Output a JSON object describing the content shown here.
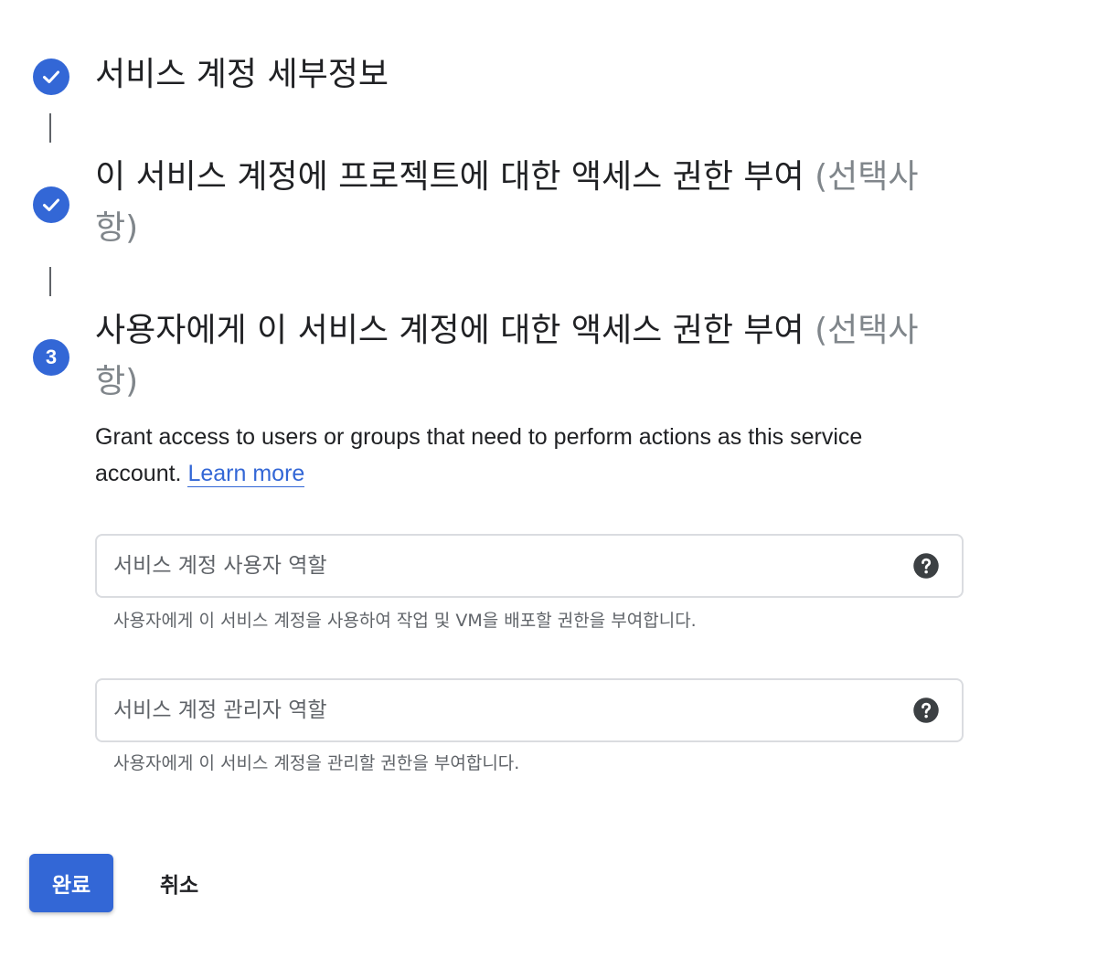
{
  "steps": [
    {
      "status": "completed",
      "title": "서비스 계정 세부정보"
    },
    {
      "status": "completed",
      "title": "이 서비스 계정에 프로젝트에 대한 액세스 권한 부여",
      "optional": "(선택사항)"
    },
    {
      "status": "active",
      "number": "3",
      "title": "사용자에게 이 서비스 계정에 대한 액세스 권한 부여",
      "optional": "(선택사항)",
      "description": "Grant access to users or groups that need to perform actions as this service account.",
      "learn_more": "Learn more"
    }
  ],
  "fields": [
    {
      "placeholder": "서비스 계정 사용자 역할",
      "value": "",
      "hint": "사용자에게 이 서비스 계정을 사용하여 작업 및 VM을 배포할 권한을 부여합니다.",
      "help_icon": "help-icon"
    },
    {
      "placeholder": "서비스 계정 관리자 역할",
      "value": "",
      "hint": "사용자에게 이 서비스 계정을 관리할 권한을 부여합니다.",
      "help_icon": "help-icon"
    }
  ],
  "actions": {
    "done_label": "완료",
    "cancel_label": "취소"
  },
  "colors": {
    "accent": "#3367d6",
    "text": "#202124",
    "muted": "#5f6368",
    "optional": "#80868b",
    "border": "#dadce0"
  }
}
